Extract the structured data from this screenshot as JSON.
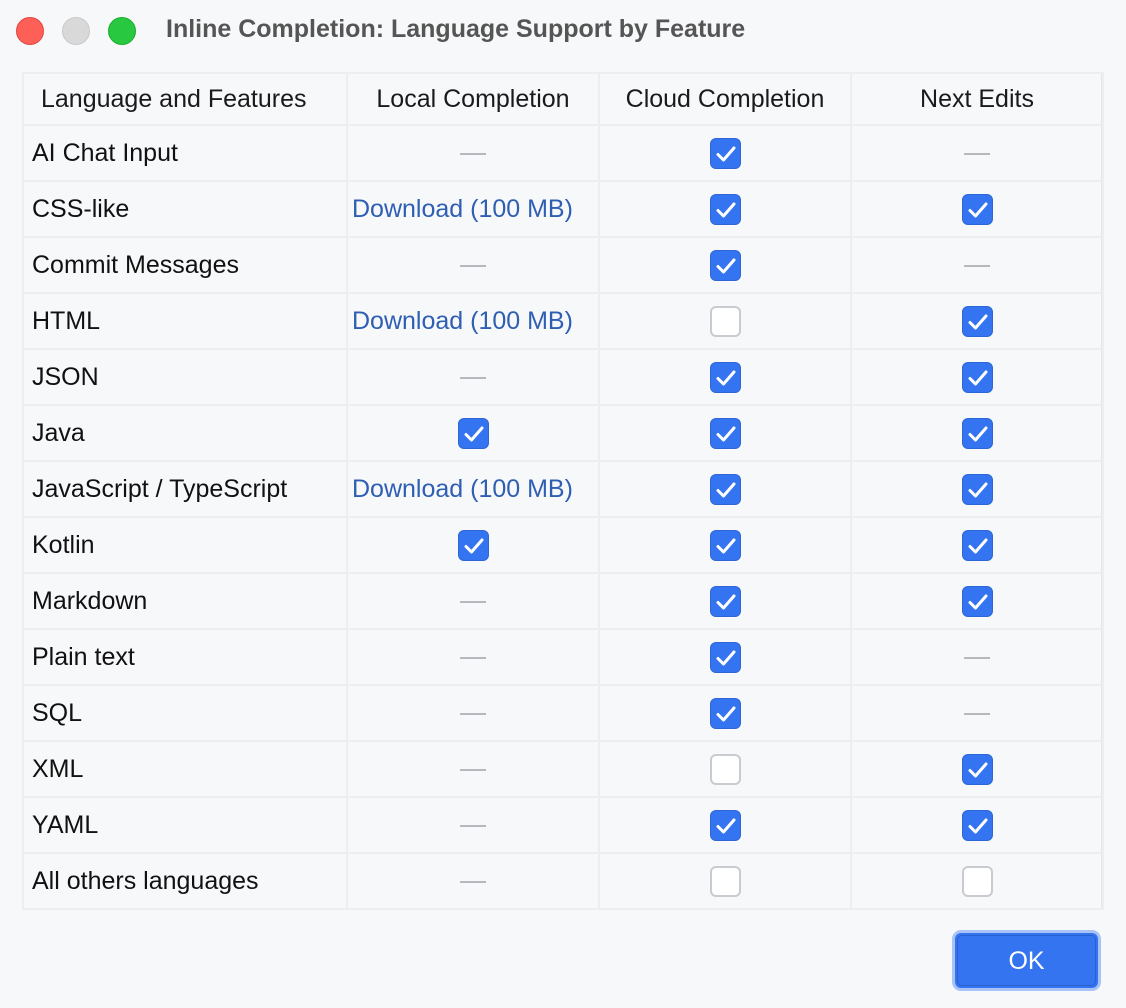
{
  "window": {
    "title": "Inline Completion: Language Support by Feature"
  },
  "table": {
    "headers": [
      "Language and Features",
      "Local Completion",
      "Cloud Completion",
      "Next Edits"
    ],
    "rows": [
      {
        "language": "AI Chat Input",
        "local": {
          "type": "dash"
        },
        "cloud": {
          "type": "checkbox",
          "checked": true
        },
        "next": {
          "type": "dash"
        }
      },
      {
        "language": "CSS-like",
        "local": {
          "type": "link",
          "text": "Download (100 MB)"
        },
        "cloud": {
          "type": "checkbox",
          "checked": true
        },
        "next": {
          "type": "checkbox",
          "checked": true
        }
      },
      {
        "language": "Commit Messages",
        "local": {
          "type": "dash"
        },
        "cloud": {
          "type": "checkbox",
          "checked": true
        },
        "next": {
          "type": "dash"
        }
      },
      {
        "language": "HTML",
        "local": {
          "type": "link",
          "text": "Download (100 MB)"
        },
        "cloud": {
          "type": "checkbox",
          "checked": false
        },
        "next": {
          "type": "checkbox",
          "checked": true
        }
      },
      {
        "language": "JSON",
        "local": {
          "type": "dash"
        },
        "cloud": {
          "type": "checkbox",
          "checked": true
        },
        "next": {
          "type": "checkbox",
          "checked": true
        }
      },
      {
        "language": "Java",
        "local": {
          "type": "checkbox",
          "checked": true
        },
        "cloud": {
          "type": "checkbox",
          "checked": true
        },
        "next": {
          "type": "checkbox",
          "checked": true
        }
      },
      {
        "language": "JavaScript / TypeScript",
        "local": {
          "type": "link",
          "text": "Download (100 MB)"
        },
        "cloud": {
          "type": "checkbox",
          "checked": true
        },
        "next": {
          "type": "checkbox",
          "checked": true
        }
      },
      {
        "language": "Kotlin",
        "local": {
          "type": "checkbox",
          "checked": true
        },
        "cloud": {
          "type": "checkbox",
          "checked": true
        },
        "next": {
          "type": "checkbox",
          "checked": true
        }
      },
      {
        "language": "Markdown",
        "local": {
          "type": "dash"
        },
        "cloud": {
          "type": "checkbox",
          "checked": true
        },
        "next": {
          "type": "checkbox",
          "checked": true
        }
      },
      {
        "language": "Plain text",
        "local": {
          "type": "dash"
        },
        "cloud": {
          "type": "checkbox",
          "checked": true
        },
        "next": {
          "type": "dash"
        }
      },
      {
        "language": "SQL",
        "local": {
          "type": "dash"
        },
        "cloud": {
          "type": "checkbox",
          "checked": true
        },
        "next": {
          "type": "dash"
        }
      },
      {
        "language": "XML",
        "local": {
          "type": "dash"
        },
        "cloud": {
          "type": "checkbox",
          "checked": false
        },
        "next": {
          "type": "checkbox",
          "checked": true
        }
      },
      {
        "language": "YAML",
        "local": {
          "type": "dash"
        },
        "cloud": {
          "type": "checkbox",
          "checked": true
        },
        "next": {
          "type": "checkbox",
          "checked": true
        }
      },
      {
        "language": "All others languages",
        "local": {
          "type": "dash"
        },
        "cloud": {
          "type": "checkbox",
          "checked": false
        },
        "next": {
          "type": "checkbox",
          "checked": false
        }
      }
    ]
  },
  "footer": {
    "ok_label": "OK"
  },
  "colors": {
    "accent": "#3574f0",
    "link": "#2e5fb3",
    "background": "#f7f8fa",
    "close": "#fe5f57",
    "minimize": "#d9d9d9",
    "zoom": "#28c840"
  }
}
